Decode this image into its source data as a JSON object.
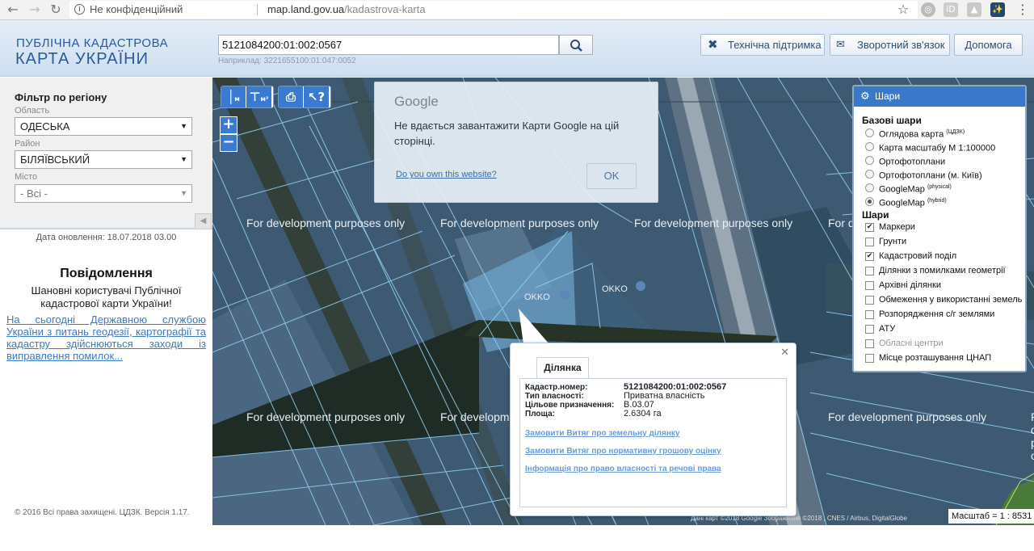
{
  "browser": {
    "security_label": "Не конфіденційний",
    "url_host": "map.land.gov.ua",
    "url_path": "/kadastrova-karta"
  },
  "header": {
    "logo_line1": "ПУБЛІЧНА КАДАСТРОВА",
    "logo_line2": "КАРТА УКРАЇНИ",
    "search_value": "5121084200:01:002:0567",
    "search_hint": "Наприклад: 3221655100:01:047:0052",
    "support_label": "Технічна підтримка",
    "feedback_label": "Зворотний зв'язок",
    "help_label": "Допомога"
  },
  "sidebar": {
    "filter_title": "Фільтр по регіону",
    "oblast_label": "Область",
    "oblast_value": "ОДЕСЬКА",
    "rayon_label": "Район",
    "rayon_value": "БІЛЯЇВСЬКИЙ",
    "city_label": "Місто",
    "city_value": "- Всі -",
    "update_date": "Дата оновлення: 18.07.2018 03.00",
    "notice_title": "Повідомлення",
    "notice_body": "Шановні користувачі Публічної кадастрової карти України!",
    "notice_link": "На сьогодні Державною службою України з питань геодезії, картографії та кадастру здійснюються заходи із виправлення помилок...",
    "copyright": "© 2016 Всі права захищені. ЦДЗК. Версія 1.17."
  },
  "map": {
    "watermark": "For development purposes only",
    "poi_label": "OKKO",
    "attribution": "Дані карт ©2018 Google Зображення ©2018 , CNES / Airbus, DigitalGlobe",
    "scale": "Масштаб = 1 : 8531"
  },
  "google_dialog": {
    "brand": "Google",
    "message": "Не вдається завантажити Карти Google на цій сторінці.",
    "link": "Do you own this website?",
    "ok": "OK"
  },
  "layers_panel": {
    "title": "Шари",
    "base_title": "Базові шари",
    "base_layers": [
      {
        "label": "Оглядова карта",
        "sup": "(ЦДЗК)",
        "selected": false
      },
      {
        "label": "Карта масштабу М 1:100000",
        "sup": "",
        "selected": false
      },
      {
        "label": "Ортофотоплани",
        "sup": "",
        "selected": false
      },
      {
        "label": "Ортофотоплани (м. Київ)",
        "sup": "",
        "selected": false
      },
      {
        "label": "GoogleMap",
        "sup": "(physical)",
        "selected": false
      },
      {
        "label": "GoogleMap",
        "sup": "(hybrid)",
        "selected": true
      }
    ],
    "overlay_title": "Шари",
    "overlays": [
      {
        "label": "Маркери",
        "checked": true,
        "disabled": false
      },
      {
        "label": "Грунти",
        "checked": false,
        "disabled": false
      },
      {
        "label": "Кадастровий поділ",
        "checked": true,
        "disabled": false
      },
      {
        "label": "Ділянки з помилками геометрії",
        "checked": false,
        "disabled": false
      },
      {
        "label": "Архівні ділянки",
        "checked": false,
        "disabled": false
      },
      {
        "label": "Обмеження у використанні земель",
        "checked": false,
        "disabled": false
      },
      {
        "label": "Розпорядження с/г землями",
        "checked": false,
        "disabled": false
      },
      {
        "label": "АТУ",
        "checked": false,
        "disabled": false
      },
      {
        "label": "Обласні центри",
        "checked": false,
        "disabled": true
      },
      {
        "label": "Місце розташування ЦНАП",
        "checked": false,
        "disabled": false
      }
    ]
  },
  "parcel_popup": {
    "tab": "Ділянка",
    "rows": [
      {
        "label": "Кадастр.номер:",
        "value": "5121084200:01:002:0567"
      },
      {
        "label": "Тип власності:",
        "value": "Приватна власність"
      },
      {
        "label": "Цільове призначення:",
        "value": "В.03.07"
      },
      {
        "label": "Площа:",
        "value": "2.6304 га"
      }
    ],
    "links": [
      "Замовити Витяг про земельну ділянку",
      "Замовити Витяг про нормативну грошову оцінку",
      "Інформація про право власності та речові права"
    ]
  },
  "colors": {
    "accent": "#3a78c9",
    "parcel_line": "#8ecdf0",
    "link": "#3b7ac4"
  }
}
